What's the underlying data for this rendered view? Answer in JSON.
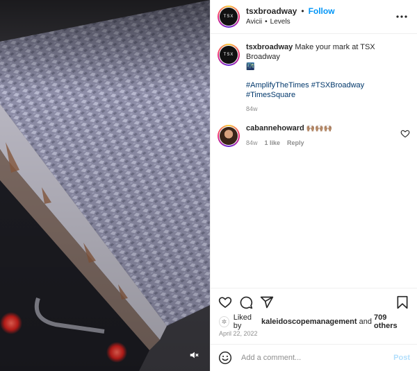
{
  "post": {
    "account": {
      "username": "tsxbroadway",
      "avatar_text": "TSX",
      "dot": "•",
      "follow_label": "Follow"
    },
    "audio": {
      "artist": "Avicii",
      "separator": "•",
      "track": "Levels"
    },
    "caption": {
      "username": "tsxbroadway",
      "text": "Make your mark at TSX Broadway",
      "emoji": "🌃",
      "hashtags": [
        "#AmplifyTheTimes",
        "#TSXBroadway",
        "#TimesSquare"
      ],
      "age": "84w"
    },
    "comments": [
      {
        "username": "cabannehoward",
        "text": "🙌🏽🙌🏽🙌🏽",
        "age": "84w",
        "likes": "1 like",
        "reply_label": "Reply"
      }
    ],
    "likes": {
      "prefix": "Liked by",
      "user": "kaleidoscopemanagement",
      "joiner": "and",
      "others": "709 others"
    },
    "date": "April 22, 2022",
    "add_comment": {
      "placeholder": "Add a comment...",
      "post_label": "Post"
    }
  },
  "icons": {
    "more": "more-options-icon",
    "like": "heart-icon",
    "comment": "comment-icon",
    "share": "share-icon",
    "save": "bookmark-icon",
    "emoji": "emoji-icon",
    "mute": "muted-speaker-icon"
  },
  "colors": {
    "accent": "#0095f6",
    "hashtag": "#00376b",
    "muted_text": "#8e8e8e",
    "post_disabled": "#b2dffc"
  }
}
